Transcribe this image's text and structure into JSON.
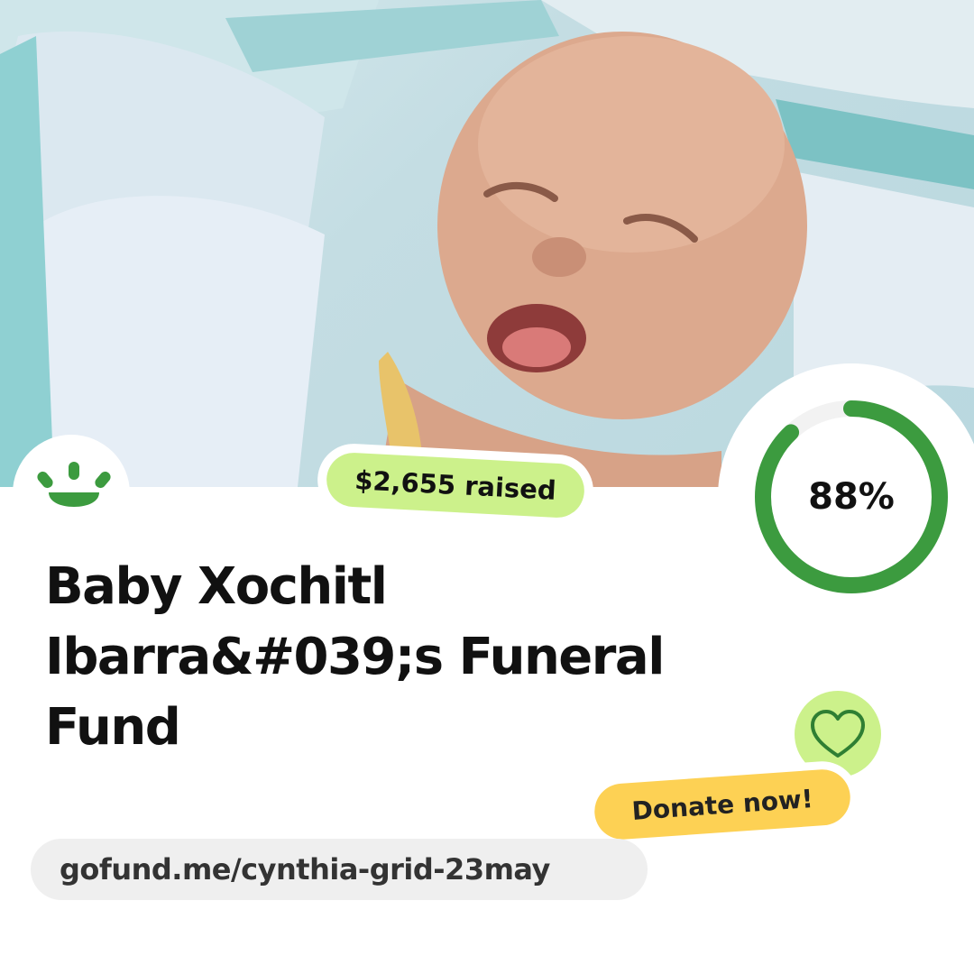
{
  "fundraiser": {
    "title": "Baby Xochitl Ibarra&#039;s Funeral Fund",
    "raised_label": "$2,655 raised",
    "progress_percent": 88,
    "progress_label": "88%",
    "donate_label": "Donate now!",
    "url": "gofund.me/cynthia-grid-23may"
  },
  "icons": {
    "logo": "gofundme-sunrise-logo",
    "heart": "heart-outline-icon"
  },
  "colors": {
    "brand_green": "#3c9b3f",
    "badge_green": "#ccf18b",
    "donate_yellow": "#fdd154",
    "url_background": "#efefef"
  }
}
